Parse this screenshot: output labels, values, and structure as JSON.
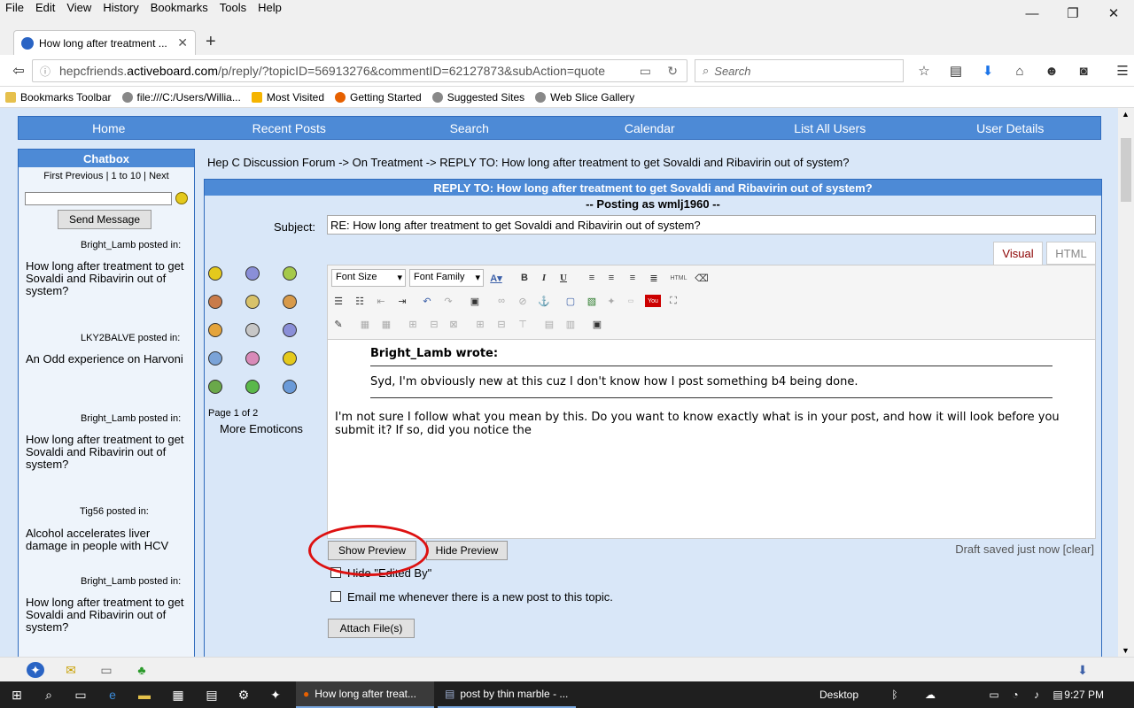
{
  "browser": {
    "menu": [
      "File",
      "Edit",
      "View",
      "History",
      "Bookmarks",
      "Tools",
      "Help"
    ],
    "tab_title": "How long after treatment ...",
    "url_prefix": "hepcfriends.",
    "url_domain": "activeboard.com",
    "url_rest": "/p/reply/?topicID=56913276&commentID=62127873&subAction=quote",
    "search_placeholder": "Search",
    "bookmarks": [
      "Bookmarks Toolbar",
      "file:///C:/Users/Willia...",
      "Most Visited",
      "Getting Started",
      "Suggested Sites",
      "Web Slice Gallery"
    ]
  },
  "nav": [
    "Home",
    "Recent Posts",
    "Search",
    "Calendar",
    "List All Users",
    "User Details"
  ],
  "chatbox": {
    "title": "Chatbox",
    "pagination": "First Previous  |  1 to 10  |  Next",
    "send_label": "Send Message",
    "posts": [
      {
        "who": "Bright_Lamb posted in:",
        "title": "How long after treatment to get Sovaldi and Ribavirin out of system?"
      },
      {
        "who": "LKY2BALVE posted in:",
        "title": "An Odd experience on Harvoni"
      },
      {
        "who": "Bright_Lamb posted in:",
        "title": "How long after treatment to get Sovaldi and Ribavirin out of system?"
      },
      {
        "who": "Tig56 posted in:",
        "title": "Alcohol accelerates liver damage in people with HCV"
      },
      {
        "who": "Bright_Lamb posted in:",
        "title": "How long after treatment to get Sovaldi and Ribavirin out of system?"
      }
    ]
  },
  "breadcrumb": "Hep C Discussion Forum -> On Treatment -> REPLY TO: How long after treatment to get Sovaldi and Ribavirin out of system?",
  "reply": {
    "header": "REPLY TO: How long after treatment to get Sovaldi and Ribavirin out of system?",
    "posting_as": "-- Posting as wmlj1960 --",
    "subject_label": "Subject:",
    "subject_value": "RE: How long after treatment to get Sovaldi and Ribavirin out of system?",
    "tab_visual": "Visual",
    "tab_html": "HTML",
    "page_of": "Page 1 of 2",
    "more_emoticons": "More Emoticons",
    "font_size": "Font Size",
    "font_family": "Font Family",
    "quote_author": "Bright_Lamb wrote:",
    "quote_text": "Syd, I'm obviously new at this cuz I don't know how I post something b4 being done.",
    "reply_text": " I'm not sure I follow what you mean by this. Do you want to know exactly what is in your post, and how it will look before you submit it? If so, did you notice the",
    "show_preview": "Show Preview",
    "hide_preview": "Hide Preview",
    "draft_status": "Draft saved just now [clear]",
    "hide_edited": "Hide \"Edited By\"",
    "email_me": "Email me whenever there is a new post to this topic.",
    "attach": "Attach File(s)"
  },
  "taskbar": {
    "task1": "How long after treat...",
    "task2": "post by thin marble - ...",
    "desktop": "Desktop",
    "time": "9:27 PM"
  },
  "colors": {
    "nav_blue": "#4d8ad6",
    "page_bg": "#d9e7f8",
    "annotation_red": "#dd1111"
  }
}
